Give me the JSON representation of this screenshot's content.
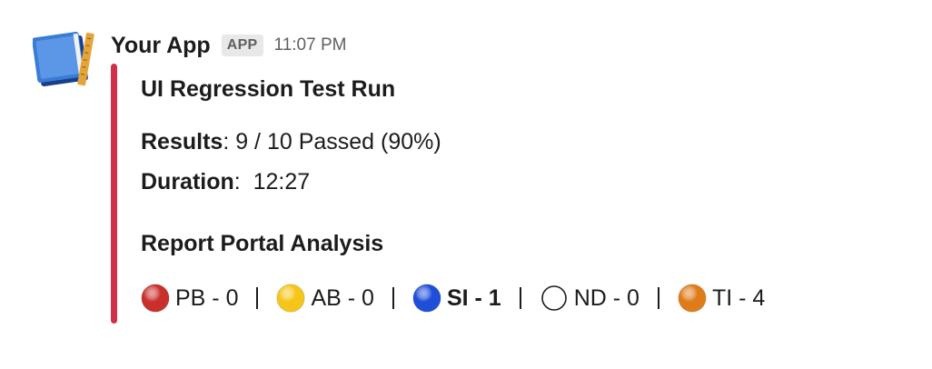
{
  "message": {
    "app_name": "Your App",
    "app_badge": "APP",
    "timestamp": "11:07 PM",
    "avatar_icon": "notebook-ruler-icon"
  },
  "attachment": {
    "color_bar": "#d0304a",
    "title": "UI Regression Test Run",
    "results_label": "Results",
    "results_value": ": 9 / 10 Passed (90%)",
    "duration_label": "Duration",
    "duration_value": ":  12:27",
    "section_title": "Report Portal Analysis"
  },
  "legend": [
    {
      "icon": "red-circle-icon",
      "color": "#c9302c",
      "label": "PB - 0",
      "bold": false
    },
    {
      "icon": "yellow-circle-icon",
      "color": "#f5c518",
      "label": "AB - 0",
      "bold": false
    },
    {
      "icon": "blue-circle-icon",
      "color": "#1f4fd8",
      "label": "SI - 1",
      "bold": true
    },
    {
      "icon": "white-circle-icon",
      "color": "#ffffff",
      "label": "ND - 0",
      "bold": false
    },
    {
      "icon": "orange-circle-icon",
      "color": "#e07b1a",
      "label": "TI - 4",
      "bold": false
    }
  ],
  "separator": "|"
}
